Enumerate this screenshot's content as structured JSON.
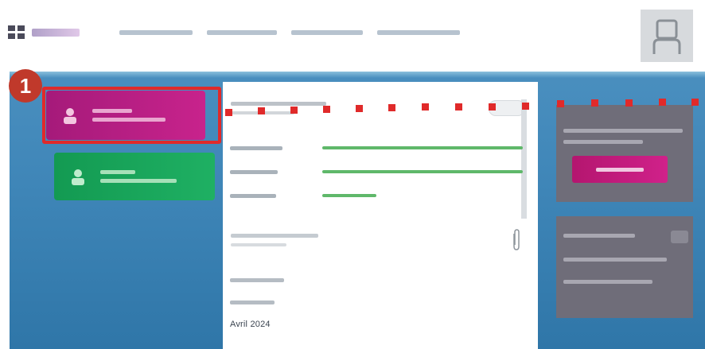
{
  "header": {
    "logo_name": "logo",
    "nav_items": [
      "",
      "",
      "",
      ""
    ],
    "user_icon": "user-avatar-icon"
  },
  "step": {
    "number": "1"
  },
  "tiles": [
    {
      "name": "tile-primary",
      "icon": "user-icon",
      "color": "#c8238c"
    },
    {
      "name": "tile-secondary",
      "icon": "user-icon",
      "color": "#1fb063"
    }
  ],
  "panel": {
    "rows": [
      {
        "label": "",
        "progress": 1.0
      },
      {
        "label": "",
        "progress": 1.0
      },
      {
        "label": "",
        "progress": 0.25
      }
    ],
    "date_text": "Avril 2024"
  },
  "right_panel": {
    "button_label": ""
  },
  "colors": {
    "highlight": "#e02a2a",
    "badge": "#c0392b",
    "accent_pink": "#c8238c",
    "accent_green": "#1fb063",
    "progress": "#5fb86a"
  }
}
